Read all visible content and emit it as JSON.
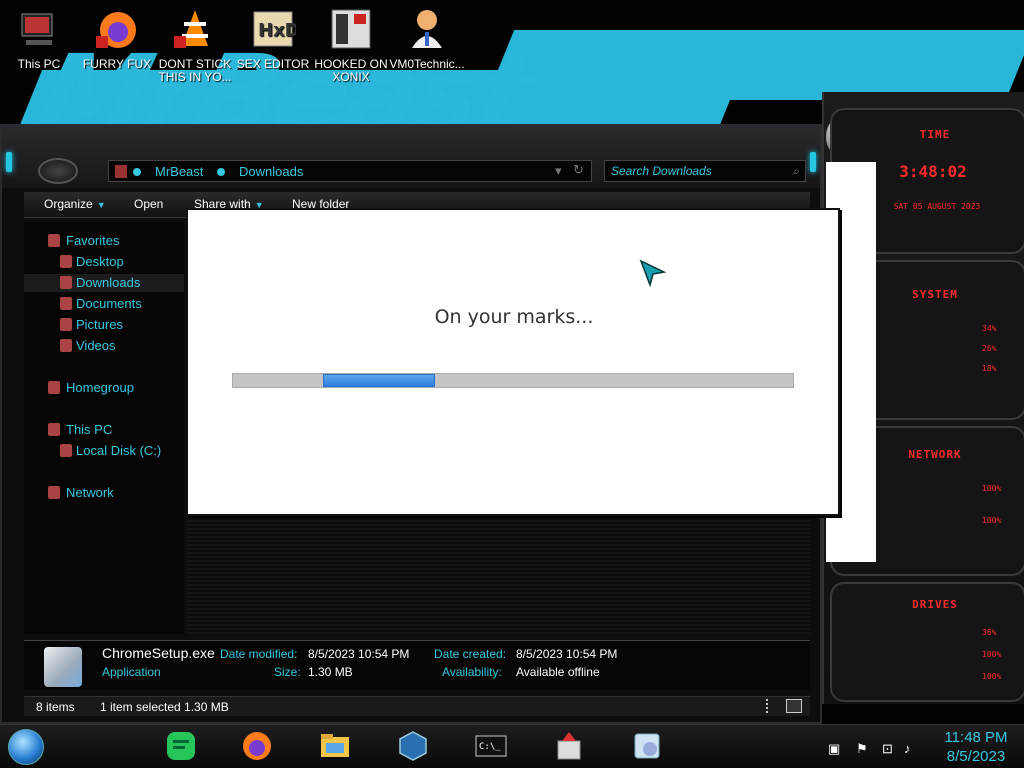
{
  "desktop": {
    "icons": [
      {
        "label": "This PC"
      },
      {
        "label": "FURRY FUX"
      },
      {
        "label": "DONT STICK THIS IN YO..."
      },
      {
        "label": "SEX EDITOR"
      },
      {
        "label": "HOOKED ON XONIX"
      },
      {
        "label": "VM0Technic..."
      }
    ],
    "wallpaper_text": "MrBeast"
  },
  "gadgets": {
    "time_title": "TIME",
    "time_value": "3:48:02",
    "date_value": "SAT 05 AUGUST 2023",
    "system_title": "SYSTEM",
    "system_rows": [
      "34%",
      "26%",
      "18%"
    ],
    "network_title": "NETWORK",
    "network_rows": [
      "100%",
      "100%"
    ],
    "drives_title": "DRIVES",
    "drives_rows": [
      "36%",
      "100%",
      "100%"
    ]
  },
  "explorer": {
    "breadcrumb": [
      "MrBeast",
      "Downloads"
    ],
    "search_placeholder": "Search Downloads",
    "toolbar": {
      "organize": "Organize",
      "open": "Open",
      "share_with": "Share with",
      "new_folder": "New folder"
    },
    "nav": {
      "favorites": "Favorites",
      "desktop": "Desktop",
      "downloads": "Downloads",
      "documents": "Documents",
      "pictures": "Pictures",
      "videos": "Videos",
      "homegroup": "Homegroup",
      "this_pc": "This PC",
      "local_disk": "Local Disk (C:)",
      "network": "Network"
    },
    "details": {
      "file_name": "ChromeSetup.exe",
      "file_type": "Application",
      "date_modified_label": "Date modified:",
      "date_modified": "8/5/2023 10:54 PM",
      "size_label": "Size:",
      "size": "1.30 MB",
      "date_created_label": "Date created:",
      "date_created": "8/5/2023 10:54 PM",
      "availability_label": "Availability:",
      "availability": "Available offline"
    },
    "status": {
      "items": "8 items",
      "selected": "1 item selected  1.30 MB"
    }
  },
  "dialog": {
    "message": "On your marks...",
    "progress": {
      "indeterminate": true,
      "segment_start": 0.16,
      "segment_end": 0.36
    }
  },
  "taskbar": {
    "time": "11:48 PM",
    "date": "8/5/2023",
    "apps": [
      "sticky-notes",
      "firefox",
      "file-explorer",
      "virtualbox",
      "command-prompt",
      "installer",
      "setup"
    ]
  },
  "colors": {
    "accent": "#36c8e0",
    "gadget_red": "#ff2a2a",
    "progress_blue": "#3f8fe8",
    "wallpaper_cyan": "#2bb8da"
  }
}
